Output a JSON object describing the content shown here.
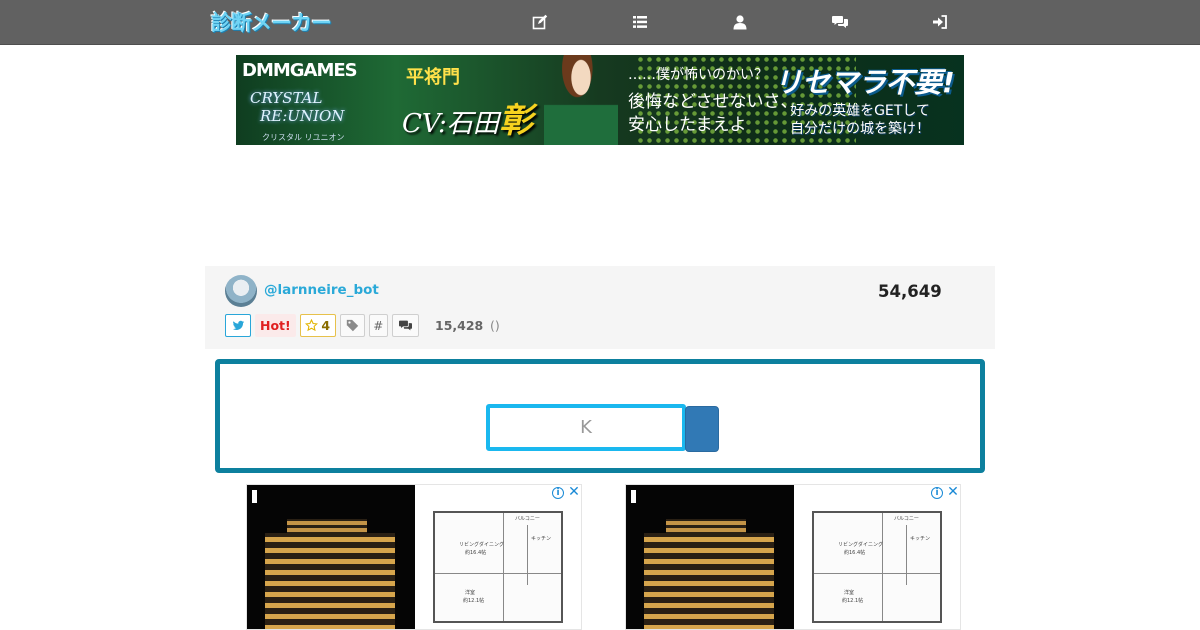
{
  "header": {
    "logo": "診断メーカー",
    "icons": [
      "edit-icon",
      "list-icon",
      "user-icon",
      "comments-icon",
      "sign-in-icon"
    ]
  },
  "banner": {
    "brand": "DMMGAMES",
    "game_title_line1": "CRYSTAL",
    "game_title_line2": "RE:UNION",
    "game_subtitle": "クリスタル リユニオン",
    "character_name": "平将門",
    "cv_prefix": "CV:",
    "cv_name_part": "石田",
    "cv_name_accent": "彰",
    "quote_line1": "……僕が怖いのかい？",
    "quote_line2": "後悔などさせないさ、",
    "quote_line3": "安心したまえよ",
    "catch": "リセマラ不要!",
    "catch_sub1": "好みの英雄をGETして",
    "catch_sub2": "自分だけの城を築け！"
  },
  "profile": {
    "username": "@larnneire_bot",
    "count": "54,649",
    "hot_label": "Hot!",
    "fav_count": "4",
    "hash_label": "#",
    "stat_count": "15,428",
    "stat_paren": "()"
  },
  "form": {
    "input_placeholder": "K",
    "input_value": ""
  },
  "ads": {
    "info_glyph": "i",
    "close_glyph": "✕",
    "plan_labels": [
      "リビングダイニング",
      "約16.4帖",
      "キッチン",
      "洋室",
      "約12.1帖",
      "バルコニー"
    ]
  },
  "colors": {
    "nav_bg": "#616161",
    "accent": "#2aa9d8",
    "form_border": "#0d809e",
    "input_border": "#1ab8ef",
    "submit_bg": "#3179b5",
    "hot": "#e02020"
  }
}
